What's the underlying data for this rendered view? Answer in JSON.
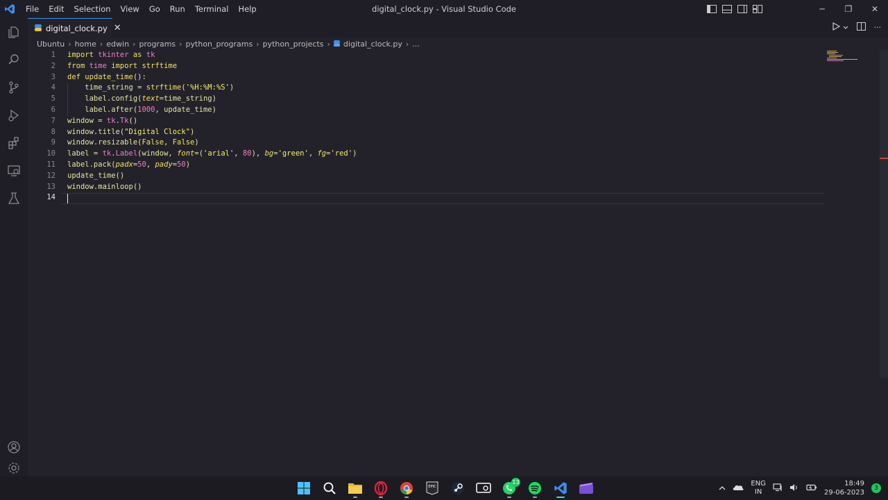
{
  "window": {
    "title": "digital_clock.py - Visual Studio Code",
    "minimize": "─",
    "restore": "❐",
    "close": "✕"
  },
  "menu": [
    "File",
    "Edit",
    "Selection",
    "View",
    "Go",
    "Run",
    "Terminal",
    "Help"
  ],
  "tab": {
    "label": "digital_clock.py",
    "close": "✕"
  },
  "editor_actions": {
    "more": "···"
  },
  "breadcrumb": {
    "parts": [
      "Ubuntu",
      "home",
      "edwin",
      "programs",
      "python_programs",
      "python_projects"
    ],
    "file": "digital_clock.py",
    "tail": "..."
  },
  "code": {
    "line_numbers": [
      "1",
      "2",
      "3",
      "4",
      "5",
      "6",
      "7",
      "8",
      "9",
      "10",
      "11",
      "12",
      "13",
      "14"
    ],
    "l1": {
      "a": "import ",
      "b": "tkinter",
      "c": " as ",
      "d": "tk"
    },
    "l2": {
      "a": "from ",
      "b": "time",
      "c": " import ",
      "d": "strftime"
    },
    "l3": {
      "a": "def ",
      "b": "update_time",
      "c": "():"
    },
    "l4": {
      "a": "    time_string = ",
      "b": "strftime",
      "c": "(",
      "d": "'%H:%M:%S'",
      "e": ")"
    },
    "l5": {
      "a": "    label.config(",
      "b": "text",
      "c": "=time_string)"
    },
    "l6": {
      "a": "    label.after(",
      "b": "1000",
      "c": ", update_time)"
    },
    "l7": {
      "a": "window = ",
      "b": "tk",
      "c": ".",
      "d": "Tk",
      "e": "()"
    },
    "l8": {
      "a": "window.title(",
      "b": "\"Digital Clock\"",
      "c": ")"
    },
    "l9": {
      "a": "window.resizable(",
      "b": "False",
      "c": ", ",
      "d": "False",
      "e": ")"
    },
    "l10": {
      "a": "label = ",
      "b": "tk",
      "c": ".",
      "d": "Label",
      "e": "(window, ",
      "f": "font",
      "g": "=(",
      "h": "'arial'",
      "i": ", ",
      "j": "80",
      "k": "), ",
      "l": "bg",
      "m": "=",
      "n": "'green'",
      "o": ", ",
      "p": "fg",
      "q": "=",
      "r": "'red'",
      "s": ")"
    },
    "l11": {
      "a": "label.pack(",
      "b": "padx",
      "c": "=",
      "d": "50",
      "e": ", ",
      "f": "pady",
      "g": "=",
      "h": "50",
      "i": ")"
    },
    "l12": {
      "a": "update_time()"
    },
    "l13": {
      "a": "window.mainloop()"
    }
  },
  "taskbar": {
    "whatsapp_badge": "13",
    "lang_1": "ENG",
    "lang_2": "IN",
    "time": "18:49",
    "date": "29-06-2023",
    "notifications": "3"
  },
  "colors": {
    "accent": "#3b8eea",
    "editor_bg": "#23222b",
    "chrome_bg": "#1f1e26",
    "keyword": "#f0e25a",
    "module": "#f07cc0"
  }
}
